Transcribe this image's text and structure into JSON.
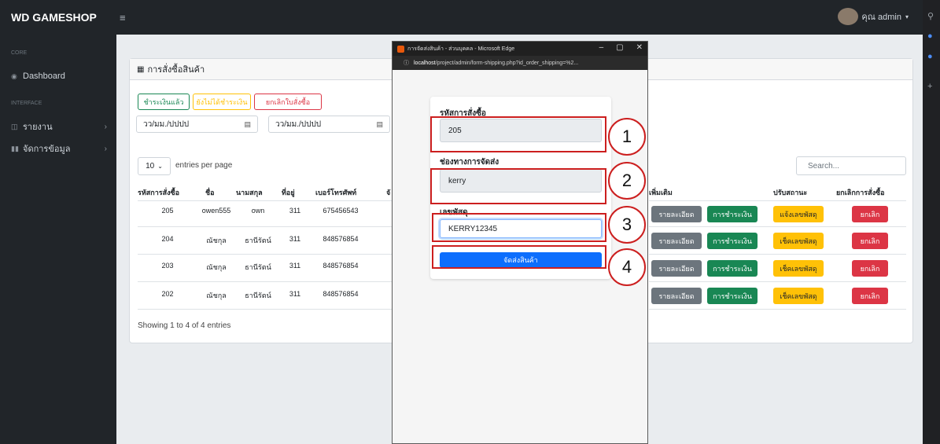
{
  "brand": "WD GAMESHOP",
  "user": "คุณ admin",
  "sidebar": {
    "core_heading": "CORE",
    "interface_heading": "INTERFACE",
    "items": [
      {
        "label": "Dashboard"
      },
      {
        "label": "รายงาน"
      },
      {
        "label": "จัดการข้อมูล"
      }
    ]
  },
  "card": {
    "title": "การสั่งซื้อสินค้า",
    "filters": [
      "ชำระเงินแล้ว",
      "ยังไม่ได้ชำระเงิน",
      "ยกเลิกใบสั่งซื้อ"
    ],
    "date_placeholder": "วว/มม./ปปปป",
    "length": "10",
    "length_label": "entries per page",
    "search_placeholder": "Search...",
    "columns": [
      "รหัสการสั่งซื้อ",
      "ชื่อ",
      "นามสกุล",
      "ที่อยู่",
      "เบอร์โทรศัพท์",
      "จั",
      "เพิ่มเติม",
      "ปรับสถานะ",
      "ยกเลิกการสั่งซื้อ"
    ],
    "rows": [
      {
        "id": "205",
        "first": "owen555",
        "last": "own",
        "addr": "311",
        "phone": "675456543",
        "status": "แจ้งเลขพัสดุ"
      },
      {
        "id": "204",
        "first": "ณัชกุล",
        "last": "ธานีรัตน์",
        "addr": "311",
        "phone": "848576854",
        "status": "เช็คเลขพัสดุ"
      },
      {
        "id": "203",
        "first": "ณัชกุล",
        "last": "ธานีรัตน์",
        "addr": "311",
        "phone": "848576854",
        "status": "เช็คเลขพัสดุ"
      },
      {
        "id": "202",
        "first": "ณัชกุล",
        "last": "ธานีรัตน์",
        "addr": "311",
        "phone": "848576854",
        "status": "เช็คเลขพัสดุ"
      }
    ],
    "detail_btn": "รายละเอียด",
    "payment_btn": "การชำระเงิน",
    "cancel_btn": "ยกเลิก",
    "showing": "Showing 1 to 4 of 4 entries"
  },
  "popup": {
    "window_title": "การจัดส่งสินค้า - ส่วนบุคคล - Microsoft Edge",
    "url_host": "localhost",
    "url_path": "/project/admin/form-shipping.php?id_order_shipping=%2...",
    "order_id_label": "รหัสการสั่งซื้อ",
    "order_id_value": "205",
    "channel_label": "ช่องทางการจัดส่ง",
    "channel_value": "kerry",
    "tracking_label": "เลขพัสดุ",
    "tracking_value": "KERRY12345",
    "submit_label": "จัดส่งสินค้า"
  },
  "callouts": [
    "1",
    "2",
    "3",
    "4"
  ],
  "colors": {
    "callout": "#cc1f1f",
    "primary": "#0d6efd",
    "success": "#198754",
    "warning": "#ffc107",
    "danger": "#dc3545",
    "secondary": "#6c757d"
  }
}
